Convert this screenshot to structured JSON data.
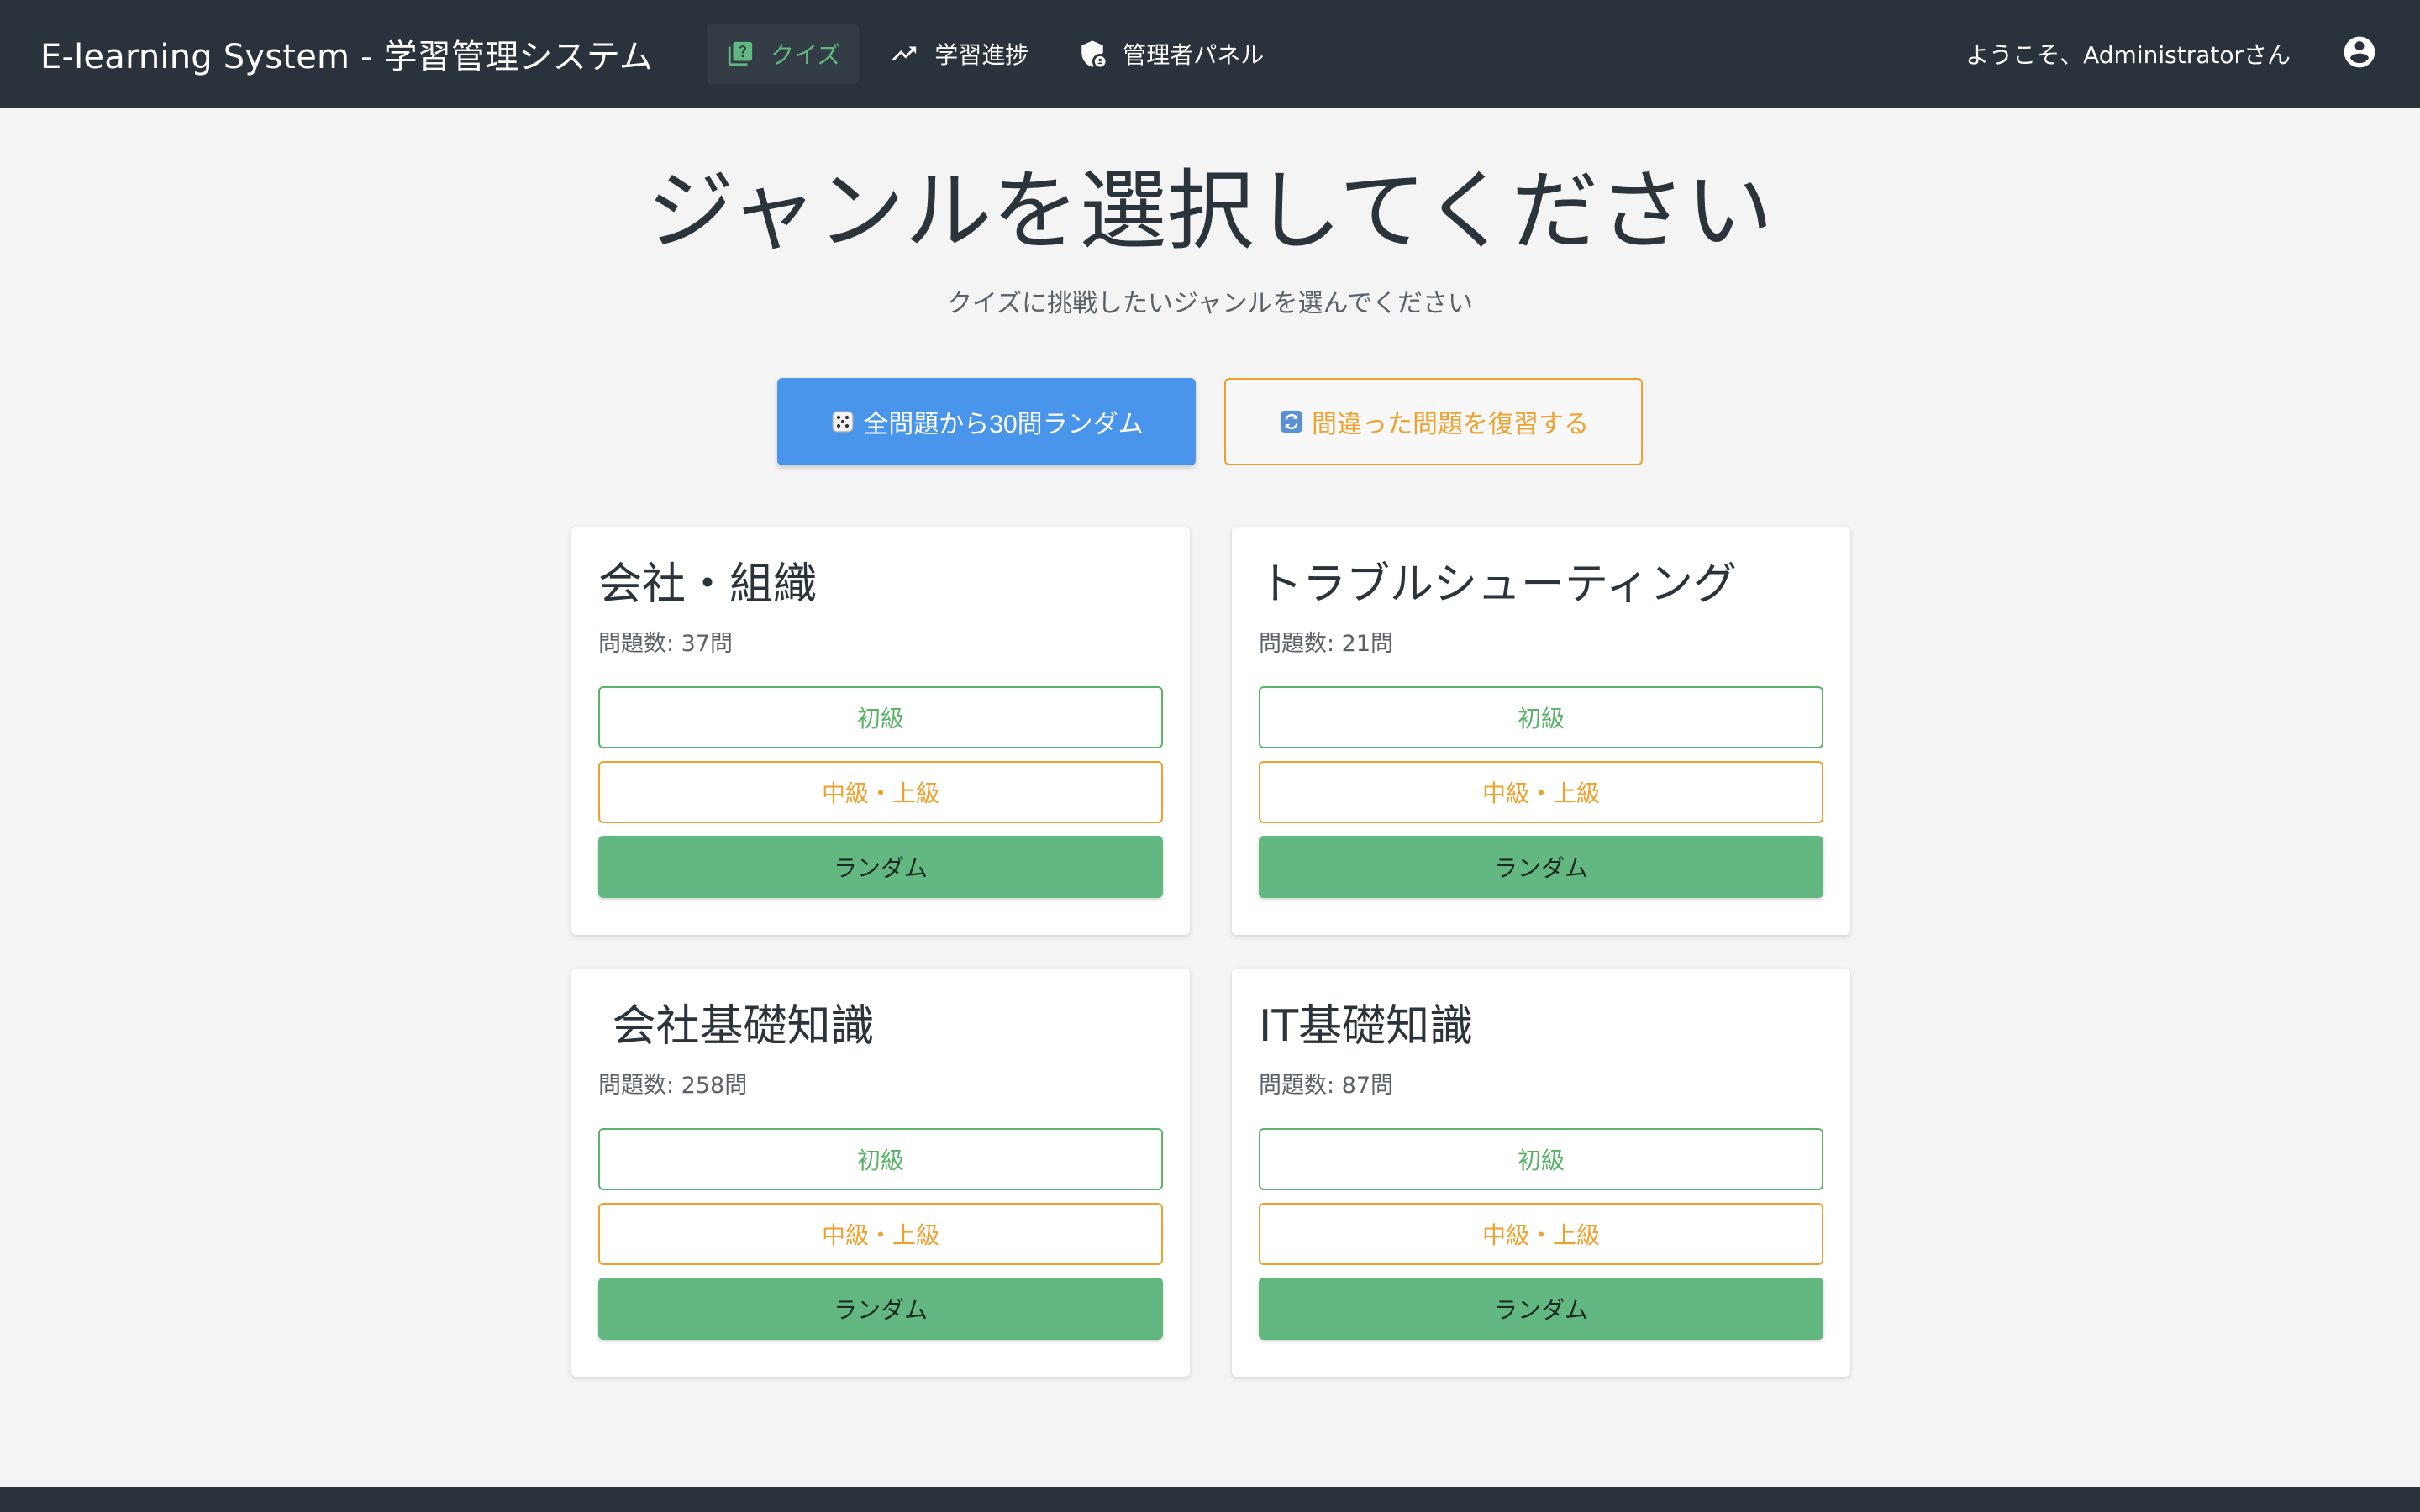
{
  "header": {
    "brand": "E-learning System - 学習管理システム",
    "nav": [
      {
        "label": "クイズ",
        "icon": "quiz-icon",
        "active": true
      },
      {
        "label": "学習進捗",
        "icon": "trending-up-icon",
        "active": false
      },
      {
        "label": "管理者パネル",
        "icon": "admin-shield-icon",
        "active": false
      }
    ],
    "welcome": "ようこそ、Administratorさん",
    "account_icon": "account-circle-icon"
  },
  "main": {
    "title": "ジャンルを選択してください",
    "subtitle": "クイズに挑戦したいジャンルを選んでください",
    "random_all_label": "全問題から30問ランダム",
    "random_all_icon": "dice-icon",
    "review_label": "間違った問題を復習する",
    "review_icon": "refresh-icon"
  },
  "genres": [
    {
      "name": "会社・組織",
      "count": "問題数: 37問",
      "beginner": "初級",
      "advanced": "中級・上級",
      "random": "ランダム"
    },
    {
      "name": "トラブルシューティング",
      "count": "問題数: 21問",
      "beginner": "初級",
      "advanced": "中級・上級",
      "random": "ランダム"
    },
    {
      "name": " 会社基礎知識",
      "count": "問題数: 258問",
      "beginner": "初級",
      "advanced": "中級・上級",
      "random": "ランダム"
    },
    {
      "name": "IT基礎知識",
      "count": "問題数: 87問",
      "beginner": "初級",
      "advanced": "中級・上級",
      "random": "ランダム"
    }
  ],
  "colors": {
    "navbar": "#2a323b",
    "active_nav": "#61b881",
    "primary": "#4a95ec",
    "warning": "#f0a02d",
    "success": "#5bb36a",
    "random_button": "#63b882"
  }
}
